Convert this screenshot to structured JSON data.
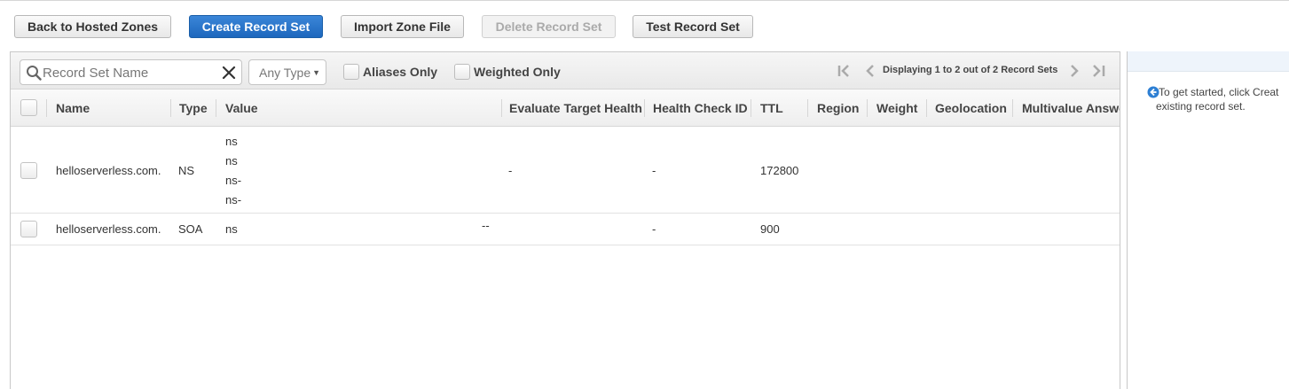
{
  "toolbar": {
    "back_label": "Back to Hosted Zones",
    "create_label": "Create Record Set",
    "import_label": "Import Zone File",
    "delete_label": "Delete Record Set",
    "test_label": "Test Record Set"
  },
  "filters": {
    "search_placeholder": "Record Set Name",
    "type_select": "Any Type",
    "aliases_only": "Aliases Only",
    "weighted_only": "Weighted Only"
  },
  "pagination": {
    "text": "Displaying 1 to 2 out of 2 Record Sets"
  },
  "columns": {
    "name": "Name",
    "type": "Type",
    "value": "Value",
    "eval": "Evaluate Target Health",
    "hcid": "Health Check ID",
    "ttl": "TTL",
    "region": "Region",
    "weight": "Weight",
    "geo": "Geolocation",
    "multi": "Multivalue Answe"
  },
  "rows": [
    {
      "name": "helloserverless.com.",
      "type": "NS",
      "values": [
        "ns",
        "ns",
        "ns-",
        "ns-"
      ],
      "eval": "-",
      "hcid": "-",
      "ttl": "172800"
    },
    {
      "name": "helloserverless.com.",
      "type": "SOA",
      "values": [
        "ns"
      ],
      "value_extra": "--",
      "hcid": "-",
      "ttl": "900"
    }
  ],
  "help": {
    "text": "To get started, click Creat",
    "text2": "existing record set."
  },
  "colors": {
    "primary": "#1d67bd",
    "link_icon": "#2d7fd3"
  }
}
